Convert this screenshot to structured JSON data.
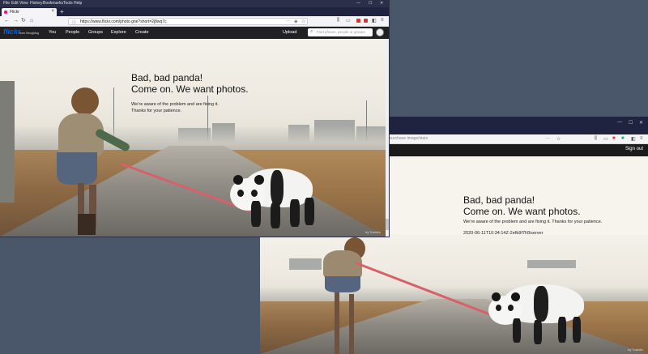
{
  "window_front": {
    "menu": [
      "File",
      "Edit",
      "View",
      "History",
      "Bookmarks",
      "Tools",
      "Help"
    ],
    "tab_title": "Flickr",
    "tab_close": "×",
    "new_tab": "+",
    "url": "https://www.flickr.com/photo.gne?short=2j8wq7c",
    "lock_glyph": "🔒",
    "more_glyph": "···",
    "flickr": {
      "logo": "flickr",
      "logo_sub": "from SmugMug",
      "nav": [
        "You",
        "People",
        "Groups",
        "Explore",
        "Create"
      ],
      "upload": "Upload",
      "search_placeholder": "Find photos, people or groups"
    },
    "message": {
      "line1": "Bad, bad panda!",
      "line2": "Come on. We want photos.",
      "body1": "We’re aware of the problem and are fixing it.",
      "body2": "Thanks for your patience."
    },
    "credit": "by Toshiko"
  },
  "window_back": {
    "url_fragment": "/purchase-image/stats",
    "sign_out": "Sign out",
    "message": {
      "line1": "Bad, bad panda!",
      "line2": "Come on. We want photos.",
      "body": "We’re aware of the problem and are fixing it. Thanks for your patience.",
      "timestamp": "2020-06-11T10:34:14Z-2efb9f7f@server"
    },
    "credit": "by Toshiko"
  },
  "colors": {
    "titlebar": "#2b2f4a",
    "flickr_blue": "#0063dc",
    "flickr_pink": "#ff0084",
    "leash": "#d8606a"
  }
}
